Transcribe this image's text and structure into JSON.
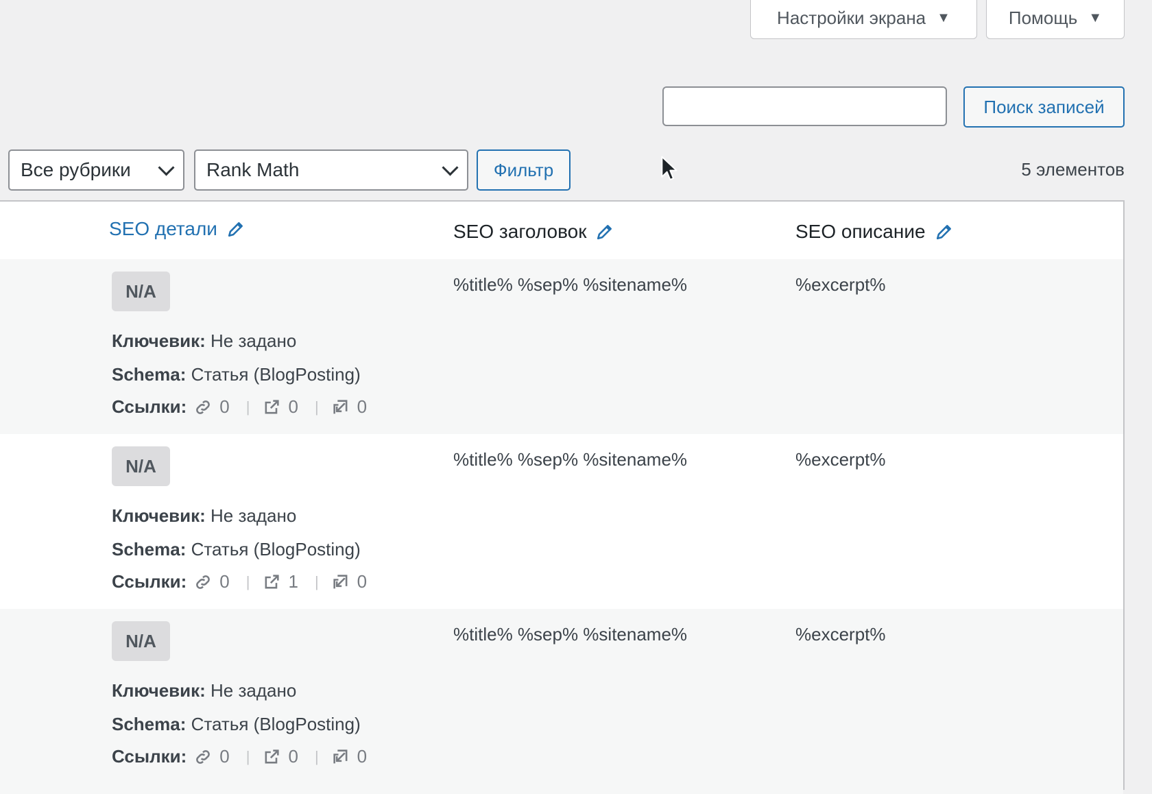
{
  "screen_meta": {
    "screen_options_label": "Настройки экрана",
    "help_label": "Помощь"
  },
  "search": {
    "placeholder": "",
    "button_label": "Поиск записей"
  },
  "filters": {
    "category_select": "Все рубрики",
    "seo_select": "Rank Math",
    "filter_button": "Фильтр",
    "items_count": "5 элементов"
  },
  "table": {
    "columns": {
      "seo_details": "SEO детали",
      "seo_title": "SEO заголовок",
      "seo_description": "SEO описание"
    },
    "labels": {
      "keyword": "Ключевик:",
      "schema": "Schema:",
      "links": "Ссылки:"
    },
    "rows": [
      {
        "score": "N/A",
        "keyword": "Не задано",
        "schema": "Статья (BlogPosting)",
        "internal": "0",
        "external": "0",
        "incoming": "0",
        "title": "%title% %sep% %sitename%",
        "description": "%excerpt%"
      },
      {
        "score": "N/A",
        "keyword": "Не задано",
        "schema": "Статья (BlogPosting)",
        "internal": "0",
        "external": "1",
        "incoming": "0",
        "title": "%title% %sep% %sitename%",
        "description": "%excerpt%"
      },
      {
        "score": "N/A",
        "keyword": "Не задано",
        "schema": "Статья (BlogPosting)",
        "internal": "0",
        "external": "0",
        "incoming": "0",
        "title": "%title% %sep% %sitename%",
        "description": "%excerpt%"
      }
    ]
  },
  "colors": {
    "accent": "#2271b1",
    "background": "#f0f0f1",
    "badge": "#dcdcde"
  }
}
